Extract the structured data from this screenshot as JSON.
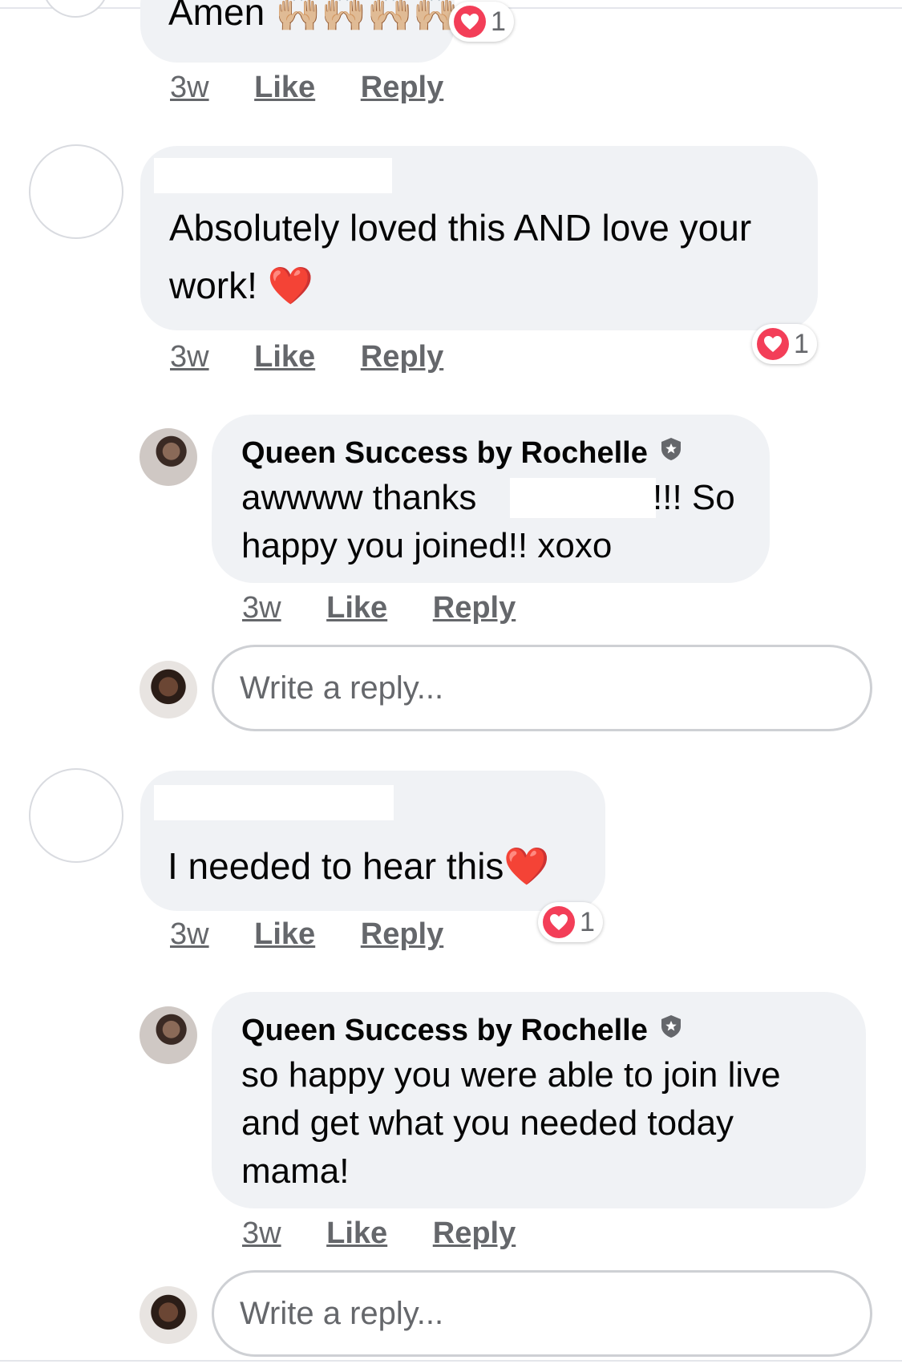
{
  "comments": [
    {
      "text": "Amen 🙌🏼🙌🏼🙌🏼🙌🏼",
      "reactions": "1",
      "meta": {
        "time": "3w",
        "like": "Like",
        "reply": "Reply"
      }
    },
    {
      "text_line1": "Absolutely loved this AND love your",
      "text_line2": "work! ",
      "reactions": "1",
      "meta": {
        "time": "3w",
        "like": "Like",
        "reply": "Reply"
      },
      "reply": {
        "author": "Queen Success by Rochelle",
        "line1_a": "awwww thanks",
        "line1_b": "!!! So",
        "line2": "happy you joined!! xoxo",
        "meta": {
          "time": "3w",
          "like": "Like",
          "reply": "Reply"
        }
      },
      "reply_input_placeholder": "Write a reply..."
    },
    {
      "text": "I needed to hear this",
      "reactions": "1",
      "meta": {
        "time": "3w",
        "like": "Like",
        "reply": "Reply"
      },
      "reply": {
        "author": "Queen Success by Rochelle",
        "line1": "so happy you were able to join live",
        "line2": "and get what you needed today",
        "line3": "mama!",
        "meta": {
          "time": "3w",
          "like": "Like",
          "reply": "Reply"
        }
      },
      "reply_input_placeholder": "Write a reply..."
    }
  ],
  "colors": {
    "bubble": "#f0f2f5",
    "heart": "#f33e58",
    "meta": "#65676b"
  },
  "icons": [
    "heart-icon",
    "verified-badge-icon",
    "heart-emoji"
  ]
}
